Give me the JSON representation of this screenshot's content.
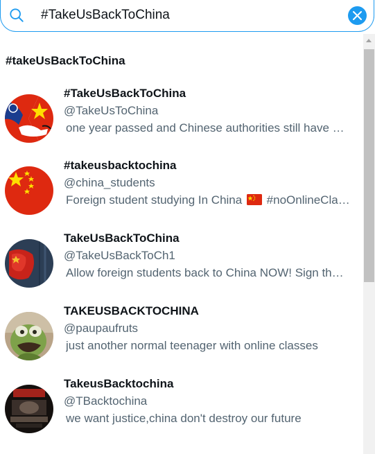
{
  "search": {
    "value": "#TakeUsBackToChina",
    "icon": "search-icon",
    "clear_icon": "close-icon",
    "accent_color": "#1d9bf0"
  },
  "query_suggestion": "#takeUsBackToChina",
  "results": [
    {
      "name": "#TakeUsBackToChina",
      "handle": "@TakeUsToChina",
      "bio": "one year passed and Chinese authorities still have not said anything about international students"
    },
    {
      "name": "#takeusbacktochina",
      "handle": "@china_students",
      "bio_before_flag": "Foreign student studying In China ",
      "bio_after_flag": " #noOnlineClasses",
      "flag_icon": "china-flag-icon"
    },
    {
      "name": "TakeUsBackToChina",
      "handle": "@TakeUsBackToCh1",
      "bio": "Allow foreign students back to China NOW! Sign the petition"
    },
    {
      "name": "TAKEUSBACKTOCHINA",
      "handle": "@paupaufruts",
      "bio": "just another normal teenager with online classes"
    },
    {
      "name": "TakeusBacktochina",
      "handle": "@TBacktochina",
      "bio": "we want justice,china don't destroy our future"
    }
  ],
  "colors": {
    "text_primary": "#0f1419",
    "text_secondary": "#536471",
    "china_red": "#de2910",
    "china_yellow": "#ffde00"
  }
}
